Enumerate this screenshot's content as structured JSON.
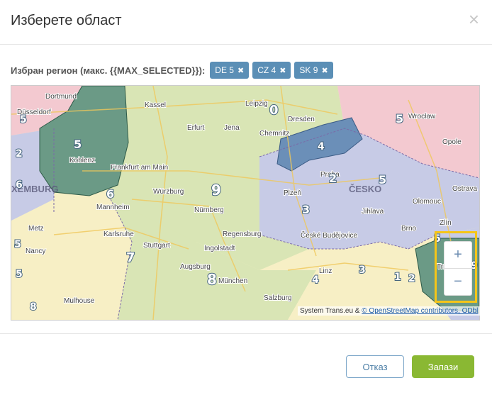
{
  "dialog": {
    "title": "Изберете област",
    "close_icon": "close-icon"
  },
  "selection": {
    "label": "Избран регион (макс. {{MAX_SELECTED}}):",
    "chips": [
      {
        "label": "DE 5",
        "remove_icon": "close-icon"
      },
      {
        "label": "CZ 4",
        "remove_icon": "close-icon"
      },
      {
        "label": "SK 9",
        "remove_icon": "close-icon"
      }
    ]
  },
  "map": {
    "region_numbers": [
      "5",
      "0",
      "5",
      "5",
      "4",
      "2",
      "5",
      "6",
      "9",
      "3",
      "5",
      "7",
      "8",
      "4",
      "3",
      "2",
      "1",
      "5",
      "9",
      "8",
      "6",
      "5",
      "2"
    ],
    "cities": [
      "Dortmund",
      "Kassel",
      "Leipzig",
      "Düsseldorf",
      "Erfurt",
      "Dresden",
      "Wrocław",
      "Jena",
      "Chemnitz",
      "Opole",
      "Koblenz",
      "Frankfurt am Main",
      "Praha",
      "Würzburg",
      "Plzeň",
      "Nürnberg",
      "Olomouc",
      "Ostrava",
      "Mannheim",
      "Jihlava",
      "Karlsruhe",
      "Stuttgart",
      "Regensburg",
      "České Budějovice",
      "Brno",
      "Zlín",
      "Metz",
      "Nancy",
      "Ingolstadt",
      "Augsburg",
      "Linz",
      "München",
      "Mulhouse",
      "Salzburg",
      "Trnava"
    ],
    "countries": [
      "ČESKO",
      "XEMBURG"
    ],
    "zoom_in": "+",
    "zoom_out": "−",
    "attribution_prefix": "System Trans.eu &",
    "attribution_link": "© OpenStreetMap contributors, ODbl"
  },
  "footer": {
    "cancel_label": "Отказ",
    "save_label": "Запази"
  },
  "colors": {
    "chip": "#5b8fb6",
    "save": "#8ab833",
    "highlight": "#f5c518",
    "region_green": "#d9e5b5",
    "region_blue": "#c7cbe6",
    "region_pink": "#f3c9d0",
    "region_yellow": "#f7efc5",
    "selected_de": "#6b9a86",
    "selected_cz": "#6b8fb8"
  }
}
